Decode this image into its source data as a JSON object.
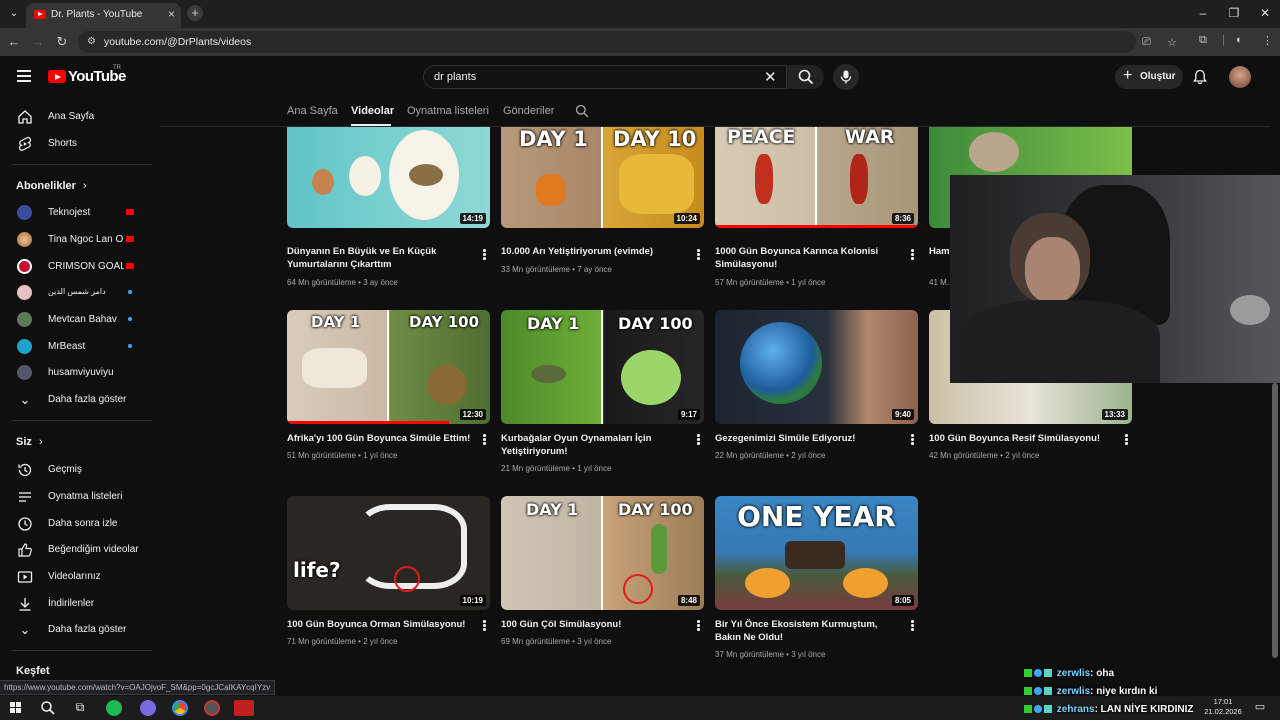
{
  "browser": {
    "tab_title": "Dr. Plants - YouTube",
    "url": "youtube.com/@DrPlants/videos"
  },
  "header": {
    "logo_text": "YouTube",
    "logo_region": "TR",
    "search_value": "dr plants",
    "create_label": "Oluştur"
  },
  "sidebar": {
    "main": [
      {
        "label": "Ana Sayfa",
        "icon": "home-icon"
      },
      {
        "label": "Shorts",
        "icon": "shorts-icon"
      }
    ],
    "subscriptions_title": "Abonelikler",
    "subscriptions": [
      {
        "label": "Teknojest",
        "status": "live",
        "color": "#3b4c9e"
      },
      {
        "label": "Tina Ngoc Lan O...",
        "status": "live",
        "color": "#d89b6a"
      },
      {
        "label": "CRIMSON GOAL ...",
        "status": "live",
        "color": "#c8102e"
      },
      {
        "label": "دامر شمس الدين",
        "status": "new",
        "color": "#e7c2c2"
      },
      {
        "label": "Mevtcan Bahav",
        "status": "new",
        "color": "#5c7a5a"
      },
      {
        "label": "MrBeast",
        "status": "new",
        "color": "#1fa3c9"
      },
      {
        "label": "husamviyuviyu",
        "status": "",
        "color": "#55566a"
      }
    ],
    "subscriptions_more": "Daha fazla göster",
    "you_title": "Siz",
    "you": [
      {
        "label": "Geçmiş",
        "icon": "history-icon"
      },
      {
        "label": "Oynatma listeleri",
        "icon": "playlists-icon"
      },
      {
        "label": "Daha sonra izle",
        "icon": "watch-later-icon"
      },
      {
        "label": "Beğendiğim videolar",
        "icon": "like-icon"
      },
      {
        "label": "Videolarınız",
        "icon": "your-videos-icon"
      },
      {
        "label": "İndirilenler",
        "icon": "download-icon"
      }
    ],
    "you_more": "Daha fazla göster",
    "explore_title": "Keşfet"
  },
  "channel_tabs": [
    {
      "label": "Ana Sayfa",
      "active": false
    },
    {
      "label": "Videolar",
      "active": true
    },
    {
      "label": "Oynatma listeleri",
      "active": false
    },
    {
      "label": "Gönderiler",
      "active": false
    }
  ],
  "videos": [
    {
      "title": "Dünyanın En Büyük ve En Küçük Yumurtalarını Çıkarttım",
      "views": "64 Mn görüntüleme",
      "age": "3 ay önce",
      "duration": "14:19",
      "thumb_text": [],
      "progress": 0
    },
    {
      "title": "10.000 Arı Yetiştiriyorum (evimde)",
      "views": "33 Mn görüntüleme",
      "age": "7 ay önce",
      "duration": "10:24",
      "thumb_text": [
        "DAY 1",
        "DAY 10"
      ],
      "progress": 0
    },
    {
      "title": "1000 Gün Boyunca Karınca Kolonisi Simülasyonu!",
      "views": "57 Mn görüntüleme",
      "age": "1 yıl önce",
      "duration": "8:36",
      "thumb_text": [
        "PEACE",
        "WAR"
      ],
      "progress": 1.0
    },
    {
      "title": "Ham...",
      "views": "41 M...",
      "age": "",
      "duration": "",
      "thumb_text": [],
      "progress": 0
    },
    {
      "title": "Afrika'yı 100 Gün Boyunca Simüle Ettim!",
      "views": "51 Mn görüntüleme",
      "age": "1 yıl önce",
      "duration": "12:30",
      "thumb_text": [
        "DAY 1",
        "DAY 100"
      ],
      "progress": 0.8
    },
    {
      "title": "Kurbağalar Oyun Oynamaları İçin Yetiştiriyorum!",
      "views": "21 Mn görüntüleme",
      "age": "1 yıl önce",
      "duration": "9:17",
      "thumb_text": [
        "DAY 1",
        "DAY 100"
      ],
      "progress": 0
    },
    {
      "title": "Gezegenimizi Simüle Ediyoruz!",
      "views": "22 Mn görüntüleme",
      "age": "2 yıl önce",
      "duration": "9:40",
      "thumb_text": [],
      "progress": 0
    },
    {
      "title": "100 Gün Boyunca Resif Simülasyonu!",
      "views": "42 Mn görüntüleme",
      "age": "2 yıl önce",
      "duration": "13:33",
      "thumb_text": [],
      "progress": 0
    },
    {
      "title": "100 Gün Boyunca Orman Simülasyonu!",
      "views": "71 Mn görüntüleme",
      "age": "2 yıl önce",
      "duration": "10:19",
      "thumb_text": [
        "life?"
      ],
      "progress": 0
    },
    {
      "title": "100 Gün Çöl Simülasyonu!",
      "views": "69 Mn görüntüleme",
      "age": "3 yıl önce",
      "duration": "8:48",
      "thumb_text": [
        "DAY 1",
        "DAY 100"
      ],
      "progress": 0
    },
    {
      "title": "Bir Yıl Önce Ekosistem Kurmuştum, Bakın Ne Oldu!",
      "views": "37 Mn görüntüleme",
      "age": "3 yıl önce",
      "duration": "8:05",
      "thumb_text": [
        "ONE YEAR"
      ],
      "progress": 0
    }
  ],
  "status_url": "https://www.youtube.com/watch?v=OAJOjvoF_SM&pp=0gcJCaIKAYcqIYzv",
  "chat": [
    {
      "user": "zerwlis",
      "message": ": oha"
    },
    {
      "user": "zerwlis",
      "message": ": niye kırdın ki"
    },
    {
      "user": "zehrans",
      "message": ": LAN NİYE KIRDINIZ"
    }
  ],
  "taskbar": {
    "time": "17:01",
    "date": "21.02.2026"
  }
}
